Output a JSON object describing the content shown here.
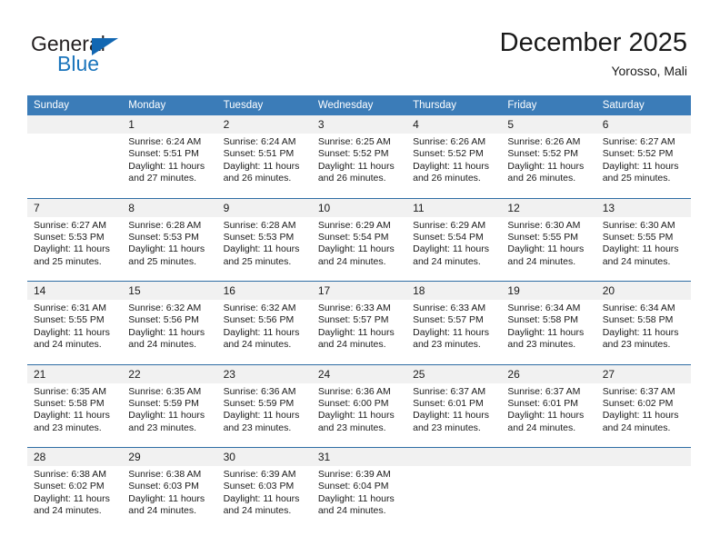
{
  "brand": {
    "name_top": "General",
    "name_bottom": "Blue",
    "color_dark": "#231f20",
    "color_blue": "#1b75bc"
  },
  "header": {
    "month_title": "December 2025",
    "location": "Yorosso, Mali"
  },
  "theme": {
    "header_blue": "#3b7cb8",
    "row_divider_blue": "#2e6da4",
    "daynum_band": "#f1f1f1"
  },
  "weekdays": [
    "Sunday",
    "Monday",
    "Tuesday",
    "Wednesday",
    "Thursday",
    "Friday",
    "Saturday"
  ],
  "labels": {
    "sunrise_prefix": "Sunrise:",
    "sunset_prefix": "Sunset:",
    "daylight_prefix": "Daylight:"
  },
  "weeks": [
    [
      {
        "day": ""
      },
      {
        "day": "1",
        "sunrise": "Sunrise: 6:24 AM",
        "sunset": "Sunset: 5:51 PM",
        "daylight_line1": "Daylight: 11 hours",
        "daylight_line2": "and 27 minutes."
      },
      {
        "day": "2",
        "sunrise": "Sunrise: 6:24 AM",
        "sunset": "Sunset: 5:51 PM",
        "daylight_line1": "Daylight: 11 hours",
        "daylight_line2": "and 26 minutes."
      },
      {
        "day": "3",
        "sunrise": "Sunrise: 6:25 AM",
        "sunset": "Sunset: 5:52 PM",
        "daylight_line1": "Daylight: 11 hours",
        "daylight_line2": "and 26 minutes."
      },
      {
        "day": "4",
        "sunrise": "Sunrise: 6:26 AM",
        "sunset": "Sunset: 5:52 PM",
        "daylight_line1": "Daylight: 11 hours",
        "daylight_line2": "and 26 minutes."
      },
      {
        "day": "5",
        "sunrise": "Sunrise: 6:26 AM",
        "sunset": "Sunset: 5:52 PM",
        "daylight_line1": "Daylight: 11 hours",
        "daylight_line2": "and 26 minutes."
      },
      {
        "day": "6",
        "sunrise": "Sunrise: 6:27 AM",
        "sunset": "Sunset: 5:52 PM",
        "daylight_line1": "Daylight: 11 hours",
        "daylight_line2": "and 25 minutes."
      }
    ],
    [
      {
        "day": "7",
        "sunrise": "Sunrise: 6:27 AM",
        "sunset": "Sunset: 5:53 PM",
        "daylight_line1": "Daylight: 11 hours",
        "daylight_line2": "and 25 minutes."
      },
      {
        "day": "8",
        "sunrise": "Sunrise: 6:28 AM",
        "sunset": "Sunset: 5:53 PM",
        "daylight_line1": "Daylight: 11 hours",
        "daylight_line2": "and 25 minutes."
      },
      {
        "day": "9",
        "sunrise": "Sunrise: 6:28 AM",
        "sunset": "Sunset: 5:53 PM",
        "daylight_line1": "Daylight: 11 hours",
        "daylight_line2": "and 25 minutes."
      },
      {
        "day": "10",
        "sunrise": "Sunrise: 6:29 AM",
        "sunset": "Sunset: 5:54 PM",
        "daylight_line1": "Daylight: 11 hours",
        "daylight_line2": "and 24 minutes."
      },
      {
        "day": "11",
        "sunrise": "Sunrise: 6:29 AM",
        "sunset": "Sunset: 5:54 PM",
        "daylight_line1": "Daylight: 11 hours",
        "daylight_line2": "and 24 minutes."
      },
      {
        "day": "12",
        "sunrise": "Sunrise: 6:30 AM",
        "sunset": "Sunset: 5:55 PM",
        "daylight_line1": "Daylight: 11 hours",
        "daylight_line2": "and 24 minutes."
      },
      {
        "day": "13",
        "sunrise": "Sunrise: 6:30 AM",
        "sunset": "Sunset: 5:55 PM",
        "daylight_line1": "Daylight: 11 hours",
        "daylight_line2": "and 24 minutes."
      }
    ],
    [
      {
        "day": "14",
        "sunrise": "Sunrise: 6:31 AM",
        "sunset": "Sunset: 5:55 PM",
        "daylight_line1": "Daylight: 11 hours",
        "daylight_line2": "and 24 minutes."
      },
      {
        "day": "15",
        "sunrise": "Sunrise: 6:32 AM",
        "sunset": "Sunset: 5:56 PM",
        "daylight_line1": "Daylight: 11 hours",
        "daylight_line2": "and 24 minutes."
      },
      {
        "day": "16",
        "sunrise": "Sunrise: 6:32 AM",
        "sunset": "Sunset: 5:56 PM",
        "daylight_line1": "Daylight: 11 hours",
        "daylight_line2": "and 24 minutes."
      },
      {
        "day": "17",
        "sunrise": "Sunrise: 6:33 AM",
        "sunset": "Sunset: 5:57 PM",
        "daylight_line1": "Daylight: 11 hours",
        "daylight_line2": "and 24 minutes."
      },
      {
        "day": "18",
        "sunrise": "Sunrise: 6:33 AM",
        "sunset": "Sunset: 5:57 PM",
        "daylight_line1": "Daylight: 11 hours",
        "daylight_line2": "and 23 minutes."
      },
      {
        "day": "19",
        "sunrise": "Sunrise: 6:34 AM",
        "sunset": "Sunset: 5:58 PM",
        "daylight_line1": "Daylight: 11 hours",
        "daylight_line2": "and 23 minutes."
      },
      {
        "day": "20",
        "sunrise": "Sunrise: 6:34 AM",
        "sunset": "Sunset: 5:58 PM",
        "daylight_line1": "Daylight: 11 hours",
        "daylight_line2": "and 23 minutes."
      }
    ],
    [
      {
        "day": "21",
        "sunrise": "Sunrise: 6:35 AM",
        "sunset": "Sunset: 5:58 PM",
        "daylight_line1": "Daylight: 11 hours",
        "daylight_line2": "and 23 minutes."
      },
      {
        "day": "22",
        "sunrise": "Sunrise: 6:35 AM",
        "sunset": "Sunset: 5:59 PM",
        "daylight_line1": "Daylight: 11 hours",
        "daylight_line2": "and 23 minutes."
      },
      {
        "day": "23",
        "sunrise": "Sunrise: 6:36 AM",
        "sunset": "Sunset: 5:59 PM",
        "daylight_line1": "Daylight: 11 hours",
        "daylight_line2": "and 23 minutes."
      },
      {
        "day": "24",
        "sunrise": "Sunrise: 6:36 AM",
        "sunset": "Sunset: 6:00 PM",
        "daylight_line1": "Daylight: 11 hours",
        "daylight_line2": "and 23 minutes."
      },
      {
        "day": "25",
        "sunrise": "Sunrise: 6:37 AM",
        "sunset": "Sunset: 6:01 PM",
        "daylight_line1": "Daylight: 11 hours",
        "daylight_line2": "and 23 minutes."
      },
      {
        "day": "26",
        "sunrise": "Sunrise: 6:37 AM",
        "sunset": "Sunset: 6:01 PM",
        "daylight_line1": "Daylight: 11 hours",
        "daylight_line2": "and 24 minutes."
      },
      {
        "day": "27",
        "sunrise": "Sunrise: 6:37 AM",
        "sunset": "Sunset: 6:02 PM",
        "daylight_line1": "Daylight: 11 hours",
        "daylight_line2": "and 24 minutes."
      }
    ],
    [
      {
        "day": "28",
        "sunrise": "Sunrise: 6:38 AM",
        "sunset": "Sunset: 6:02 PM",
        "daylight_line1": "Daylight: 11 hours",
        "daylight_line2": "and 24 minutes."
      },
      {
        "day": "29",
        "sunrise": "Sunrise: 6:38 AM",
        "sunset": "Sunset: 6:03 PM",
        "daylight_line1": "Daylight: 11 hours",
        "daylight_line2": "and 24 minutes."
      },
      {
        "day": "30",
        "sunrise": "Sunrise: 6:39 AM",
        "sunset": "Sunset: 6:03 PM",
        "daylight_line1": "Daylight: 11 hours",
        "daylight_line2": "and 24 minutes."
      },
      {
        "day": "31",
        "sunrise": "Sunrise: 6:39 AM",
        "sunset": "Sunset: 6:04 PM",
        "daylight_line1": "Daylight: 11 hours",
        "daylight_line2": "and 24 minutes."
      },
      {
        "day": ""
      },
      {
        "day": ""
      },
      {
        "day": ""
      }
    ]
  ]
}
